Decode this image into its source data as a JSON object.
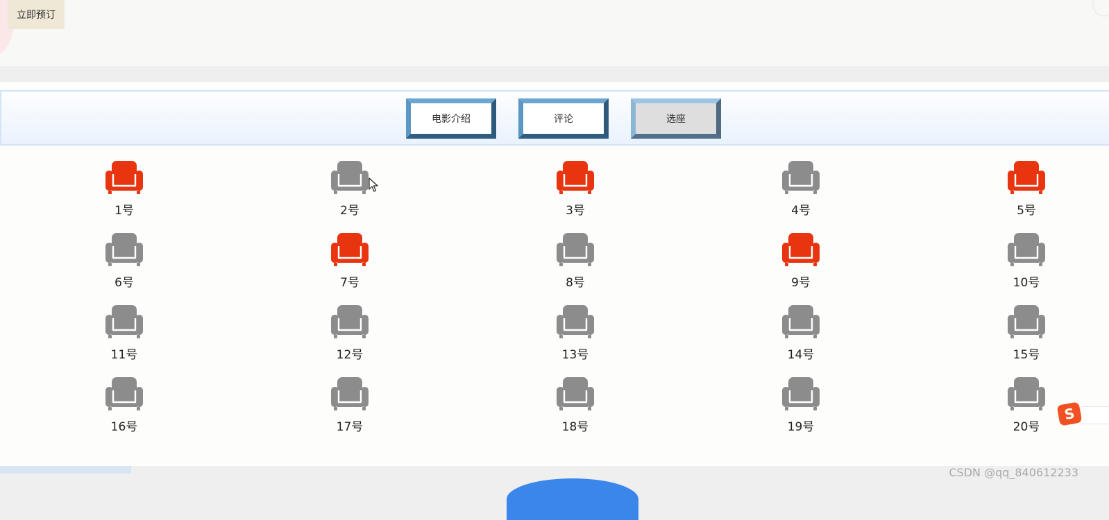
{
  "header": {
    "book_now_label": "立即预订"
  },
  "tabs": [
    {
      "label": "电影介绍",
      "active": false
    },
    {
      "label": "评论",
      "active": false
    },
    {
      "label": "选座",
      "active": true
    }
  ],
  "seats": [
    {
      "label": "1号",
      "status": "selected"
    },
    {
      "label": "2号",
      "status": "available"
    },
    {
      "label": "3号",
      "status": "selected"
    },
    {
      "label": "4号",
      "status": "available"
    },
    {
      "label": "5号",
      "status": "selected"
    },
    {
      "label": "6号",
      "status": "available"
    },
    {
      "label": "7号",
      "status": "selected"
    },
    {
      "label": "8号",
      "status": "available"
    },
    {
      "label": "9号",
      "status": "selected"
    },
    {
      "label": "10号",
      "status": "available"
    },
    {
      "label": "11号",
      "status": "available"
    },
    {
      "label": "12号",
      "status": "available"
    },
    {
      "label": "13号",
      "status": "available"
    },
    {
      "label": "14号",
      "status": "available"
    },
    {
      "label": "15号",
      "status": "available"
    },
    {
      "label": "16号",
      "status": "available"
    },
    {
      "label": "17号",
      "status": "available"
    },
    {
      "label": "18号",
      "status": "available"
    },
    {
      "label": "19号",
      "status": "available"
    },
    {
      "label": "20号",
      "status": "available"
    }
  ],
  "colors": {
    "seat_selected": "#e83510",
    "seat_available": "#8c8c8c"
  },
  "watermark": "CSDN @qq_840612233",
  "ime_badge_letter": "S",
  "icons": {
    "seat": "armchair-icon",
    "cursor": "mouse-pointer-icon",
    "ime": "sogou-input-icon"
  }
}
